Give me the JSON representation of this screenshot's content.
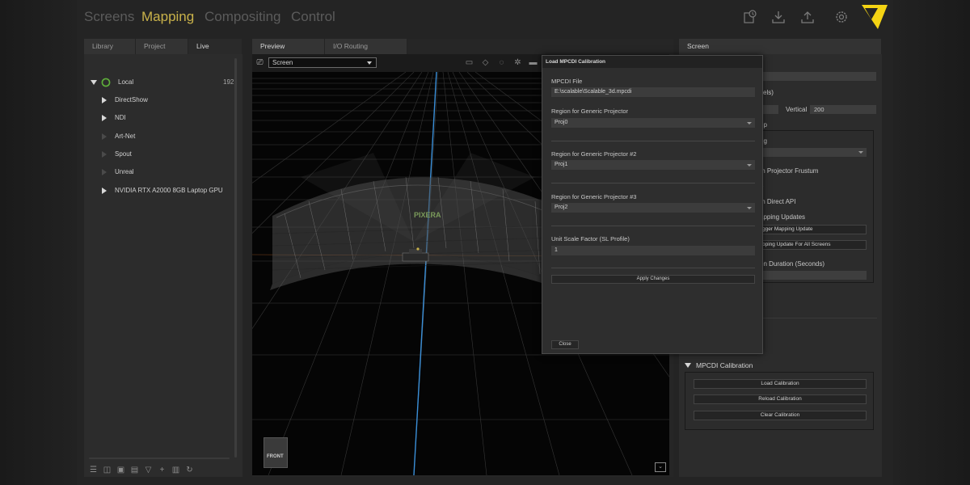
{
  "nav": {
    "tabs": [
      "Screens",
      "Mapping",
      "Compositing",
      "Control"
    ],
    "active_tab": "Mapping",
    "icons": [
      "history-icon",
      "download-icon",
      "upload-icon",
      "gear-icon"
    ]
  },
  "left_panel": {
    "tabs": [
      "Library",
      "Project",
      "Live"
    ],
    "active_tab": "Live",
    "tree": [
      {
        "label": "Local",
        "count": "192",
        "expanded": true
      },
      {
        "label": "DirectShow"
      },
      {
        "label": "NDI"
      },
      {
        "label": "Art-Net"
      },
      {
        "label": "Spout"
      },
      {
        "label": "Unreal"
      },
      {
        "label": "NVIDIA RTX A2000 8GB Laptop GPU"
      }
    ]
  },
  "center_panel": {
    "tabs": [
      "Preview",
      "I/O Routing"
    ],
    "active_tab": "Preview",
    "view_select": "Screen",
    "watermark": "PIXERA",
    "cube_label": "FRONT"
  },
  "right_panel": {
    "tab": "Screen",
    "labels": {
      "pixels": "xels)",
      "vertical": "Vertical",
      "vertical_value": "200",
      "group": "up",
      "ng": "ng",
      "frustum": "th Projector Frustum",
      "e": "e",
      "direct_api": "th Direct API",
      "mapping_updates": "apping Updates",
      "duration": "on Duration (Seconds)"
    },
    "buttons": {
      "trigger": "gger Mapping Update",
      "all_screens": "pping Update For All Screens"
    },
    "mpcdi": {
      "title": "MPCDI Calibration",
      "load": "Load Calibration",
      "reload": "Reload Calibration",
      "clear": "Clear Calibration"
    }
  },
  "dialog": {
    "title": "Load MPCDI Calibration",
    "mpcdi_file_label": "MPCDI File",
    "mpcdi_file_value": "E:\\scalable\\Scalable_3d.mpcdi",
    "region1_label": "Region for Generic Projector",
    "region1_value": "Proj0",
    "region2_label": "Region for Generic Projector #2",
    "region2_value": "Proj1",
    "region3_label": "Region for Generic Projector #3",
    "region3_value": "Proj2",
    "unit_label": "Unit Scale Factor (SL Profile)",
    "unit_value": "1",
    "apply_label": "Apply Changes",
    "close_label": "Close"
  },
  "colors": {
    "accent": "#c9b24a",
    "logo": "#f4d313",
    "status_green": "#5fb03a",
    "grid_line": "#4a4a4a",
    "axis_blue": "#3a8fd8",
    "axis_orange": "#c76a2a"
  }
}
